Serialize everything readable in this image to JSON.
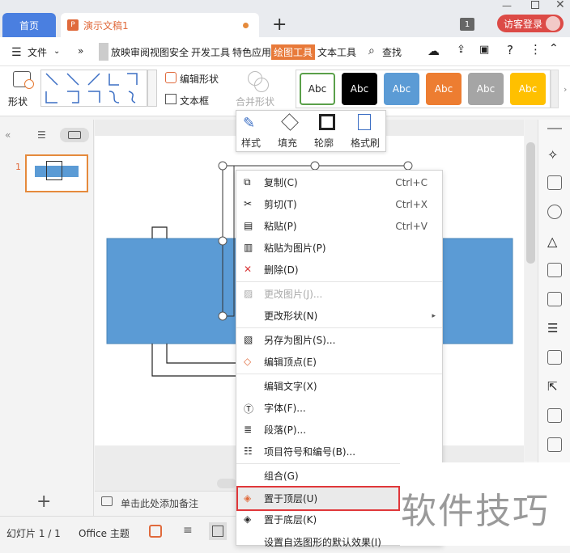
{
  "titlebar": {
    "home_tab": "首页",
    "doc_tab": "演示文稿1",
    "doc_icon_letter": "P",
    "new_tab": "+",
    "badge": "1",
    "login_button": "访客登录"
  },
  "menubar": {
    "items": [
      "文件",
      "»",
      "放映",
      "审阅",
      "视图",
      "安全",
      "开发工具",
      "特色应用",
      "绘图工具",
      "文本工具",
      "查找"
    ],
    "active": "绘图工具"
  },
  "ribbon": {
    "shape_button": "形状",
    "edit_shape": "编辑形状",
    "text_box": "文本框",
    "merge_shape": "合并形状",
    "styles": [
      {
        "label": "Abc",
        "bg": "#ffffff",
        "fg": "#222222",
        "border": "#5aa04a"
      },
      {
        "label": "Abc",
        "bg": "#000000",
        "fg": "#ffffff",
        "border": "#000000"
      },
      {
        "label": "Abc",
        "bg": "#5b9bd5",
        "fg": "#ffffff",
        "border": "#5b9bd5"
      },
      {
        "label": "Abc",
        "bg": "#ed7d31",
        "fg": "#ffffff",
        "border": "#ed7d31"
      },
      {
        "label": "Abc",
        "bg": "#a5a5a5",
        "fg": "#ffffff",
        "border": "#a5a5a5"
      },
      {
        "label": "Abc",
        "bg": "#ffc000",
        "fg": "#ffffff",
        "border": "#ffc000"
      }
    ]
  },
  "slide_panel": {
    "slide_number": "1",
    "add": "+",
    "notes_placeholder": "单击此处添加备注"
  },
  "float_toolbar": {
    "style": "样式",
    "fill": "填充",
    "outline": "轮廓",
    "format_painter": "格式刷"
  },
  "context_menu": {
    "items": [
      {
        "label": "复制(C)",
        "shortcut": "Ctrl+C",
        "icon": "copy-icon"
      },
      {
        "label": "剪切(T)",
        "shortcut": "Ctrl+X",
        "icon": "scissors-icon"
      },
      {
        "label": "粘贴(P)",
        "shortcut": "Ctrl+V",
        "icon": "paste-icon"
      },
      {
        "label": "粘贴为图片(P)",
        "shortcut": "",
        "icon": "paste-image-icon"
      },
      {
        "label": "删除(D)",
        "shortcut": "",
        "icon": "delete-icon"
      },
      {
        "label": "更改图片(J)...",
        "shortcut": "",
        "icon": "image-icon",
        "disabled": true
      },
      {
        "label": "更改形状(N)",
        "shortcut": "",
        "icon": "",
        "submenu": true
      },
      {
        "label": "另存为图片(S)...",
        "shortcut": "",
        "icon": "save-image-icon"
      },
      {
        "label": "编辑顶点(E)",
        "shortcut": "",
        "icon": "edit-points-icon"
      },
      {
        "label": "编辑文字(X)",
        "shortcut": "",
        "icon": ""
      },
      {
        "label": "字体(F)...",
        "shortcut": "",
        "icon": "font-icon"
      },
      {
        "label": "段落(P)...",
        "shortcut": "",
        "icon": "paragraph-icon"
      },
      {
        "label": "项目符号和编号(B)...",
        "shortcut": "",
        "icon": "bullets-icon"
      },
      {
        "label": "组合(G)",
        "shortcut": "",
        "icon": ""
      },
      {
        "label": "置于顶层(U)",
        "shortcut": "",
        "icon": "bring-front-icon"
      },
      {
        "label": "置于底层(K)",
        "shortcut": "",
        "icon": "send-back-icon"
      },
      {
        "label": "设置自选图形的默认效果(I)",
        "shortcut": "",
        "icon": ""
      }
    ],
    "highlighted": "置于顶层(U)"
  },
  "statusbar": {
    "slide_info": "幻灯片 1 / 1",
    "theme": "Office 主题"
  },
  "watermark": "软件技巧"
}
